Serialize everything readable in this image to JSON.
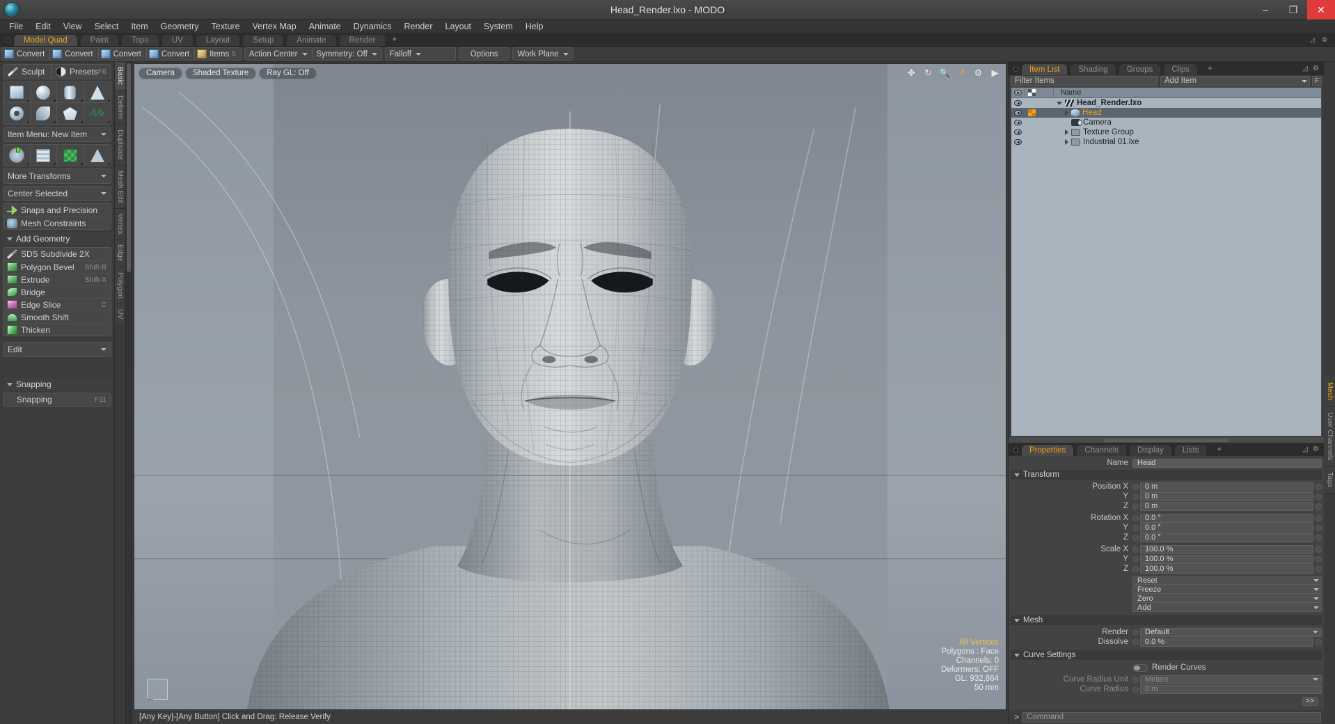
{
  "window": {
    "title": "Head_Render.lxo - MODO",
    "app_icon": "modo-logo-icon",
    "minimize": "–",
    "maximize": "❐",
    "close": "✕"
  },
  "menubar": {
    "items": [
      "File",
      "Edit",
      "View",
      "Select",
      "Item",
      "Geometry",
      "Texture",
      "Vertex Map",
      "Animate",
      "Dynamics",
      "Render",
      "Layout",
      "System",
      "Help"
    ]
  },
  "layout_tabs": {
    "items": [
      {
        "label": "Model Quad",
        "active": true
      },
      {
        "label": "Paint",
        "active": false
      },
      {
        "label": "Topo",
        "active": false
      },
      {
        "label": "UV",
        "active": false
      },
      {
        "label": "Layout",
        "active": false
      },
      {
        "label": "Setup",
        "active": false
      },
      {
        "label": "Animate",
        "active": false
      },
      {
        "label": "Render",
        "active": false
      }
    ],
    "add_label": "+"
  },
  "toolstrip": {
    "convert_buttons": [
      {
        "label": "Convert",
        "icon": "cube-blue-icon"
      },
      {
        "label": "Convert",
        "icon": "cube-blue-icon"
      },
      {
        "label": "Convert",
        "icon": "cube-blue-icon"
      },
      {
        "label": "Convert",
        "icon": "cube-blue-icon"
      }
    ],
    "items_button": {
      "label": "Items",
      "icon": "cube-gold-icon",
      "hotkey": "5"
    },
    "action_center": "Action Center",
    "symmetry": "Symmetry: Off",
    "falloff": "Falloff",
    "options": "Options",
    "work_plane": "Work Plane"
  },
  "left_toolbox": {
    "top_buttons": [
      {
        "label": "Sculpt",
        "icon": "pencil-icon"
      },
      {
        "label": "Presets",
        "icon": "sphere-half-icon",
        "hotkey": "F6"
      }
    ],
    "primitives_row1": [
      {
        "name": "cube-primitive"
      },
      {
        "name": "sphere-primitive"
      },
      {
        "name": "cylinder-primitive"
      },
      {
        "name": "cone-primitive"
      }
    ],
    "primitives_row2": [
      {
        "name": "torus-primitive"
      },
      {
        "name": "helix-primitive"
      },
      {
        "name": "polygon-primitive"
      },
      {
        "name": "text-primitive"
      }
    ],
    "item_menu": "Item Menu: New Item",
    "transform_row": [
      {
        "name": "transform-axis-tool"
      },
      {
        "name": "bend-grid-tool"
      },
      {
        "name": "checker-deform-tool"
      },
      {
        "name": "taper-tool"
      }
    ],
    "more_transforms": "More Transforms",
    "center_selected": "Center Selected",
    "snaps": [
      {
        "label": "Snaps and Precision",
        "icon": "snap-arrow-icon"
      },
      {
        "label": "Mesh Constraints",
        "icon": "mesh-constraint-icon"
      }
    ],
    "add_geometry_header": "Add Geometry",
    "geometry_items": [
      {
        "label": "SDS Subdivide 2X",
        "hotkey": "",
        "icon": "sds-icon"
      },
      {
        "label": "Polygon Bevel",
        "hotkey": "Shift-B",
        "icon": "green-cube-icon"
      },
      {
        "label": "Extrude",
        "hotkey": "Shift-X",
        "icon": "green-cube-icon"
      },
      {
        "label": "Bridge",
        "hotkey": "",
        "icon": "bridge-icon"
      },
      {
        "label": "Edge Slice",
        "hotkey": "C",
        "icon": "pink-cube-icon"
      },
      {
        "label": "Smooth Shift",
        "hotkey": "",
        "icon": "smooth-shift-icon"
      },
      {
        "label": "Thicken",
        "hotkey": "",
        "icon": "thicken-icon"
      }
    ],
    "edit_dropdown": "Edit",
    "snapping_header": "Snapping",
    "snapping_item": {
      "label": "Snapping",
      "hotkey": "F11"
    },
    "mode_tabs": [
      "Basic",
      "Deform",
      "Duplicate",
      "Mesh Edit",
      "Vertex",
      "Edge",
      "Polygon",
      "UV"
    ]
  },
  "viewport": {
    "buttons": [
      "Camera",
      "Shaded Texture",
      "Ray GL: Off"
    ],
    "icons": [
      "move-icon",
      "rotate-icon",
      "zoom-icon",
      "fit-icon",
      "gear-icon",
      "play-icon"
    ],
    "stats": {
      "selection": "All Vertices",
      "polygons": "Polygons : Face",
      "channels": "Channels: 0",
      "deformers": "Deformers: OFF",
      "gl": "GL: 932,864",
      "scale": "50 mm"
    }
  },
  "statusbar": {
    "text": "[Any Key]-[Any Button] Click and Drag:   Release Verify"
  },
  "item_list": {
    "tabs": [
      {
        "label": "Item List",
        "active": true
      },
      {
        "label": "Shading",
        "active": false
      },
      {
        "label": "Groups",
        "active": false
      },
      {
        "label": "Clips",
        "active": false
      }
    ],
    "add_tab": "+",
    "filter_placeholder": "Filter Items",
    "add_item_label": "Add Item",
    "filter_badge": "F",
    "columns": [
      "eye-icon",
      "shading-icon",
      "deform-icon",
      "Name"
    ],
    "name_column": "Name",
    "rows": [
      {
        "name": "Head_Render.lxo",
        "icon": "scene-icon",
        "indent": 0,
        "bold": true,
        "expanded": true,
        "selected": false,
        "has_eye": true,
        "has_orange": false
      },
      {
        "name": "Head",
        "icon": "mesh-icon",
        "indent": 1,
        "bold": false,
        "expanded": false,
        "selected": true,
        "has_eye": true,
        "has_orange": true
      },
      {
        "name": "Camera",
        "icon": "camera-icon",
        "indent": 1,
        "bold": false,
        "expanded": false,
        "selected": false,
        "has_eye": true,
        "has_orange": false
      },
      {
        "name": "Texture Group",
        "icon": "folder-icon",
        "indent": 1,
        "bold": false,
        "expanded": false,
        "selected": false,
        "has_eye": true,
        "has_orange": false
      },
      {
        "name": "Industrial 01.lxe",
        "icon": "folder-icon",
        "indent": 1,
        "bold": false,
        "expanded": false,
        "selected": false,
        "has_eye": true,
        "has_orange": false
      }
    ]
  },
  "properties": {
    "tabs": [
      {
        "label": "Properties",
        "active": true
      },
      {
        "label": "Channels",
        "active": false
      },
      {
        "label": "Display",
        "active": false
      },
      {
        "label": "Lists",
        "active": false
      }
    ],
    "add_tab": "+",
    "name_label": "Name",
    "name_value": "Head",
    "transform_header": "Transform",
    "transform_rows": [
      {
        "label": "Position X",
        "value": "0 m"
      },
      {
        "label": "Y",
        "value": "0 m"
      },
      {
        "label": "Z",
        "value": "0 m"
      },
      {
        "label": "Rotation X",
        "value": "0.0 °"
      },
      {
        "label": "Y",
        "value": "0.0 °"
      },
      {
        "label": "Z",
        "value": "0.0 °"
      },
      {
        "label": "Scale X",
        "value": "100.0 %"
      },
      {
        "label": "Y",
        "value": "100.0 %"
      },
      {
        "label": "Z",
        "value": "100.0 %"
      }
    ],
    "action_buttons": [
      "Reset",
      "Freeze",
      "Zero",
      "Add"
    ],
    "mesh_header": "Mesh",
    "mesh_rows": [
      {
        "label": "Render",
        "value": "Default",
        "type": "dropdown"
      },
      {
        "label": "Dissolve",
        "value": "0.0 %",
        "type": "field"
      }
    ],
    "curve_header": "Curve Settings",
    "render_curves_label": "Render Curves",
    "curve_rows": [
      {
        "label": "Curve Radius Unit",
        "value": "Meters",
        "type": "dropdown",
        "disabled": true
      },
      {
        "label": "Curve Radius",
        "value": "0 m",
        "type": "field",
        "disabled": true
      }
    ],
    "more_button": ">>"
  },
  "right_vtabs": [
    "Mesh",
    "User Channels",
    "Tags"
  ],
  "command_bar": {
    "prompt": ">",
    "placeholder": "Command"
  },
  "colors": {
    "accent": "#f2a21c",
    "panel_bg": "#3c3c3c",
    "viewport_bg": "#8d96a0",
    "close_red": "#e03b3b"
  }
}
